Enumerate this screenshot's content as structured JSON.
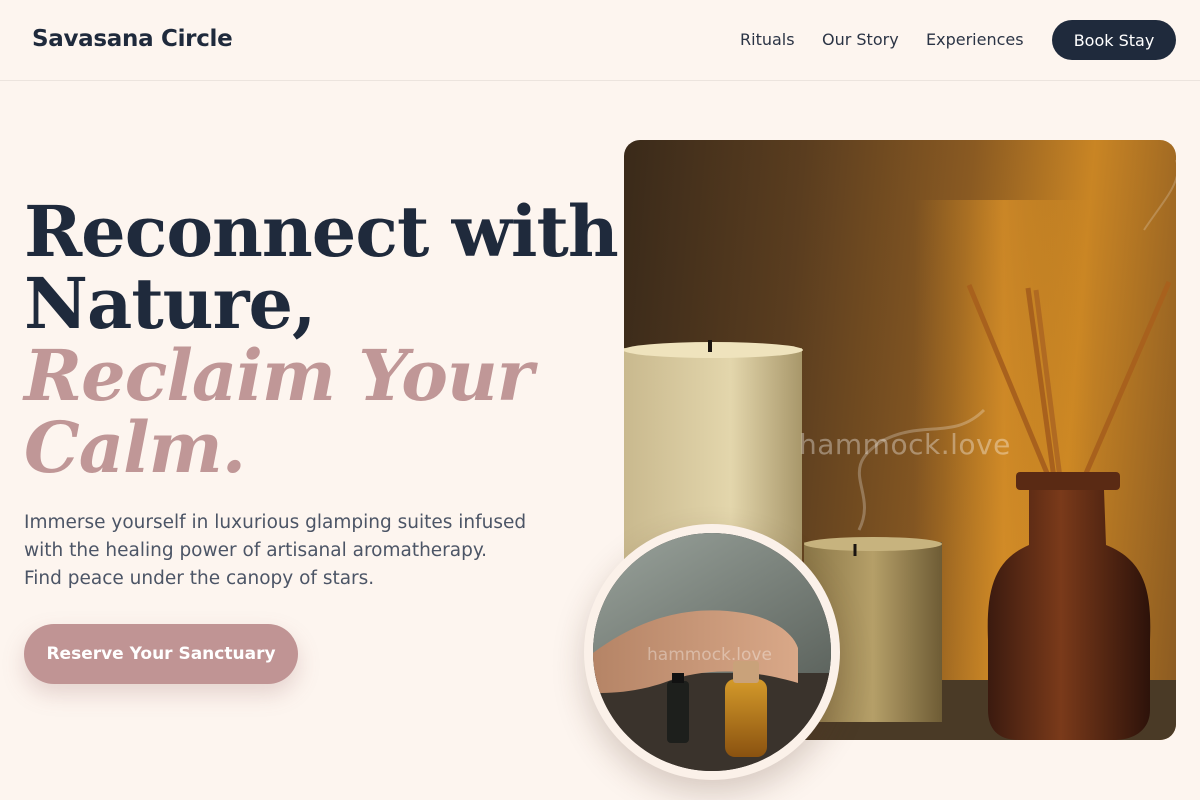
{
  "nav": {
    "brand": "Savasana Circle",
    "links": [
      "Rituals",
      "Our Story",
      "Experiences"
    ],
    "cta": "Book Stay"
  },
  "hero": {
    "title_line1": "Reconnect with",
    "title_line2": "Nature,",
    "title_accent_line1": "Reclaim Your",
    "title_accent_line2": "Calm.",
    "subtitle_lines": [
      "Immerse yourself in luxurious glamping suites infused",
      "with the healing power of artisanal aromatherapy.",
      "Find peace under the canopy of stars."
    ],
    "cta": "Reserve Your Sanctuary"
  },
  "images": {
    "main_watermark": "hammock.love",
    "circle_watermark": "hammock.love"
  },
  "colors": {
    "background": "#fdf5ef",
    "navy": "#1f2a3c",
    "rose": "#c09494"
  }
}
